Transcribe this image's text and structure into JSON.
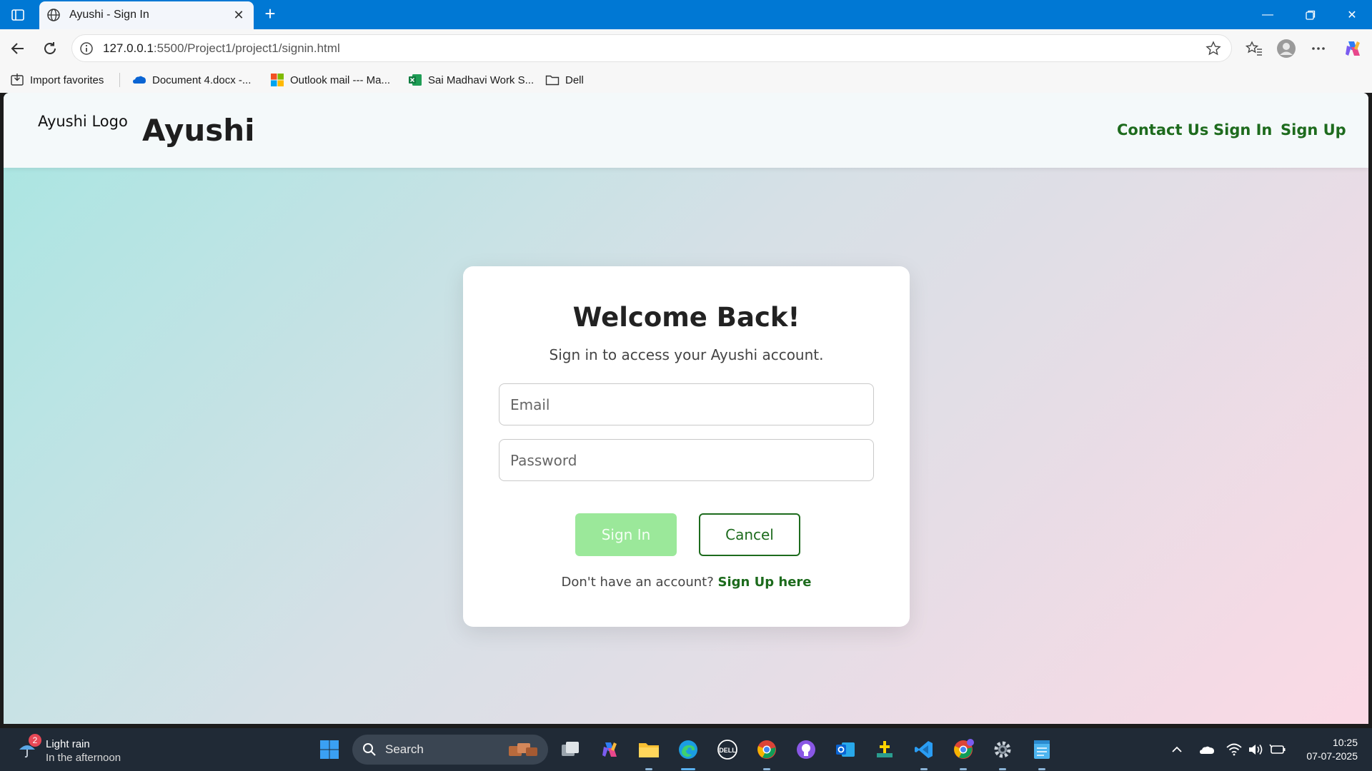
{
  "browser": {
    "tab_title": "Ayushi - Sign In",
    "url_host": "127.0.0.1",
    "url_rest": ":5500/Project1/project1/signin.html",
    "favorites": [
      {
        "label": "Import favorites",
        "icon": "import-icon"
      },
      {
        "label": "Document 4.docx -...",
        "icon": "onedrive-icon"
      },
      {
        "label": "Outlook mail --- Ma...",
        "icon": "microsoft-icon"
      },
      {
        "label": "Sai Madhavi Work S...",
        "icon": "excel-icon"
      },
      {
        "label": "Dell",
        "icon": "folder-icon"
      }
    ],
    "accent": "#0078d4"
  },
  "site": {
    "logo_alt": "Ayushi Logo",
    "brand": "Ayushi",
    "nav": [
      "Contact Us",
      "Sign In",
      "Sign Up"
    ],
    "link_color": "#1d6b1d"
  },
  "signin": {
    "title": "Welcome Back!",
    "subtitle": "Sign in to access your Ayushi account.",
    "email_placeholder": "Email",
    "password_placeholder": "Password",
    "signin_label": "Sign In",
    "cancel_label": "Cancel",
    "prompt": "Don't have an account?",
    "signup_link": "Sign Up here"
  },
  "taskbar": {
    "weather_title": "Light rain",
    "weather_sub": "In the afternoon",
    "weather_badge": "2",
    "search_label": "Search",
    "time": "10:25",
    "date": "07-07-2025"
  }
}
